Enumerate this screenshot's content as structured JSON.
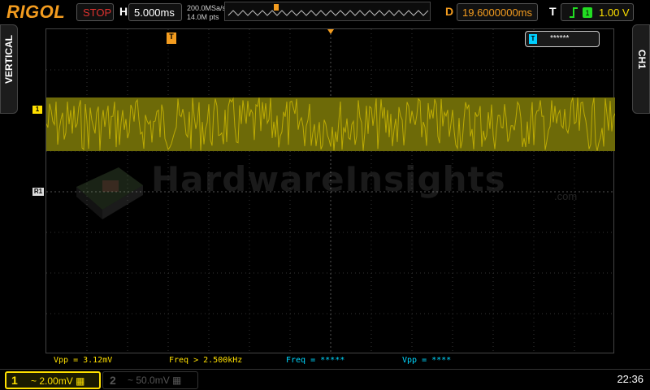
{
  "brand": "RIGOL",
  "run_state": "STOP",
  "timebase": {
    "label": "H",
    "value": "5.000ms"
  },
  "sampling": {
    "rate": "200.0MSa/s",
    "depth": "14.0M pts"
  },
  "delay": {
    "label": "D",
    "value": "19.6000000ms"
  },
  "trigger": {
    "label": "T",
    "level": "1.00 V"
  },
  "tabs": {
    "left": "VERTICAL",
    "right": "CH1"
  },
  "markers": {
    "ch1": "1",
    "ref1": "R1",
    "trigger": "T"
  },
  "overlay": {
    "icon": "T",
    "text": "******"
  },
  "watermark": {
    "text": "HardwareInsights",
    "suffix": ".com"
  },
  "measurements": [
    {
      "text": "Vpp = 3.12mV",
      "color": "yellow"
    },
    {
      "text": "Freq > 2.500kHz",
      "color": "yellow"
    },
    {
      "text": "Freq = *****",
      "color": "cyan"
    },
    {
      "text": "Vpp = ****",
      "color": "cyan"
    }
  ],
  "channels": [
    {
      "num": "1",
      "scale": "2.00mV",
      "active": true
    },
    {
      "num": "2",
      "scale": "50.0mV",
      "active": false
    }
  ],
  "clock": "22:36",
  "colors": {
    "ch1": "#ffe000",
    "accent": "#f39c1f",
    "stop": "#e0322f",
    "cyan": "#00d8ff"
  }
}
